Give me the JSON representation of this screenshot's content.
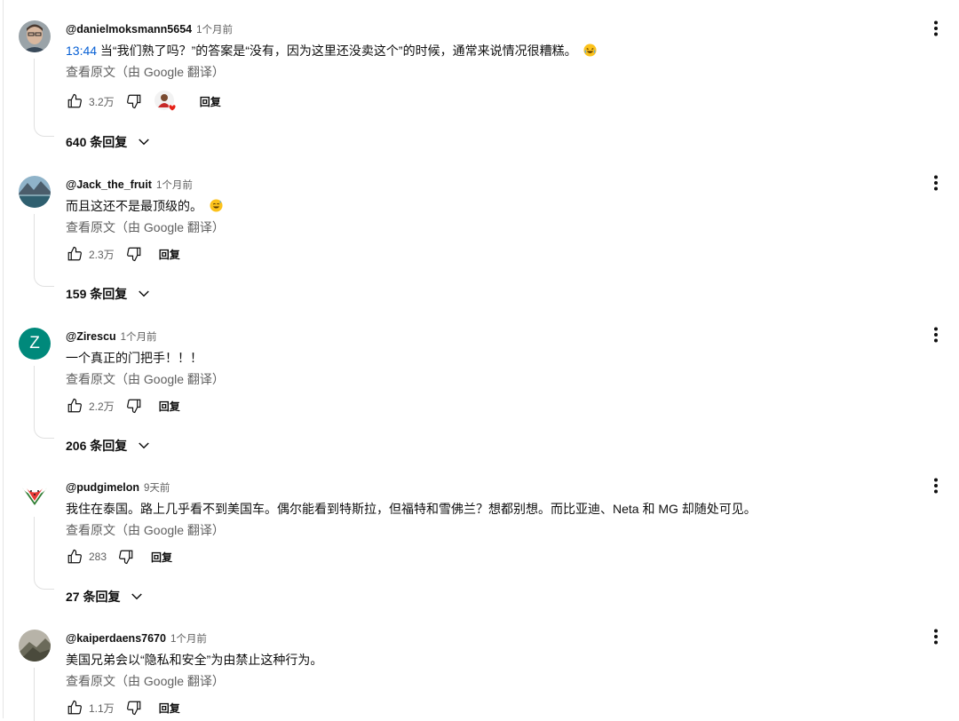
{
  "comments": [
    {
      "author": "@danielmoksmann5654",
      "time": "1个月前",
      "timestamp": "13:44",
      "text": " 当“我们熟了吗？”的答案是“没有，因为这里还没卖这个”的时候，通常来说情况很糟糕。",
      "emoji": "laugh-emoji",
      "translate": "查看原文（由 Google 翻译）",
      "likes": "3.2万",
      "reply_label": "回复",
      "replies": "640 条回复",
      "avatar_type": "photo-man",
      "has_heart": true
    },
    {
      "author": "@Jack_the_fruit",
      "time": "1个月前",
      "timestamp": "",
      "text": "而且这还不是最顶级的。",
      "emoji": "sweat-smile-emoji",
      "translate": "查看原文（由 Google 翻译）",
      "likes": "2.3万",
      "reply_label": "回复",
      "replies": "159 条回复",
      "avatar_type": "photo-lake",
      "has_heart": false
    },
    {
      "author": "@Zirescu",
      "time": "1个月前",
      "timestamp": "",
      "text": "一个真正的门把手！！！",
      "emoji": "",
      "translate": "查看原文（由 Google 翻译）",
      "likes": "2.2万",
      "reply_label": "回复",
      "replies": "206 条回复",
      "avatar_type": "letter",
      "avatar_letter": "Z",
      "avatar_color": "#00897b",
      "has_heart": false
    },
    {
      "author": "@pudgimelon",
      "time": "9天前",
      "timestamp": "",
      "text": "我住在泰国。路上几乎看不到美国车。偶尔能看到特斯拉，但福特和雪佛兰？想都别想。而比亚迪、Neta 和 MG 却随处可见。",
      "emoji": "",
      "translate": "查看原文（由 Google 翻译）",
      "likes": "283",
      "reply_label": "回复",
      "replies": "27 条回复",
      "avatar_type": "photo-melon",
      "has_heart": false
    },
    {
      "author": "@kaiperdaens7670",
      "time": "1个月前",
      "timestamp": "",
      "text": "美国兄弟会以“隐私和安全”为由禁止这种行为。",
      "emoji": "",
      "translate": "查看原文（由 Google 翻译）",
      "likes": "1.1万",
      "reply_label": "回复",
      "replies": "",
      "avatar_type": "photo-rock",
      "has_heart": false
    }
  ],
  "colors": {
    "link": "#065fd4",
    "secondary_text": "#606060",
    "heart": "#e62117"
  }
}
